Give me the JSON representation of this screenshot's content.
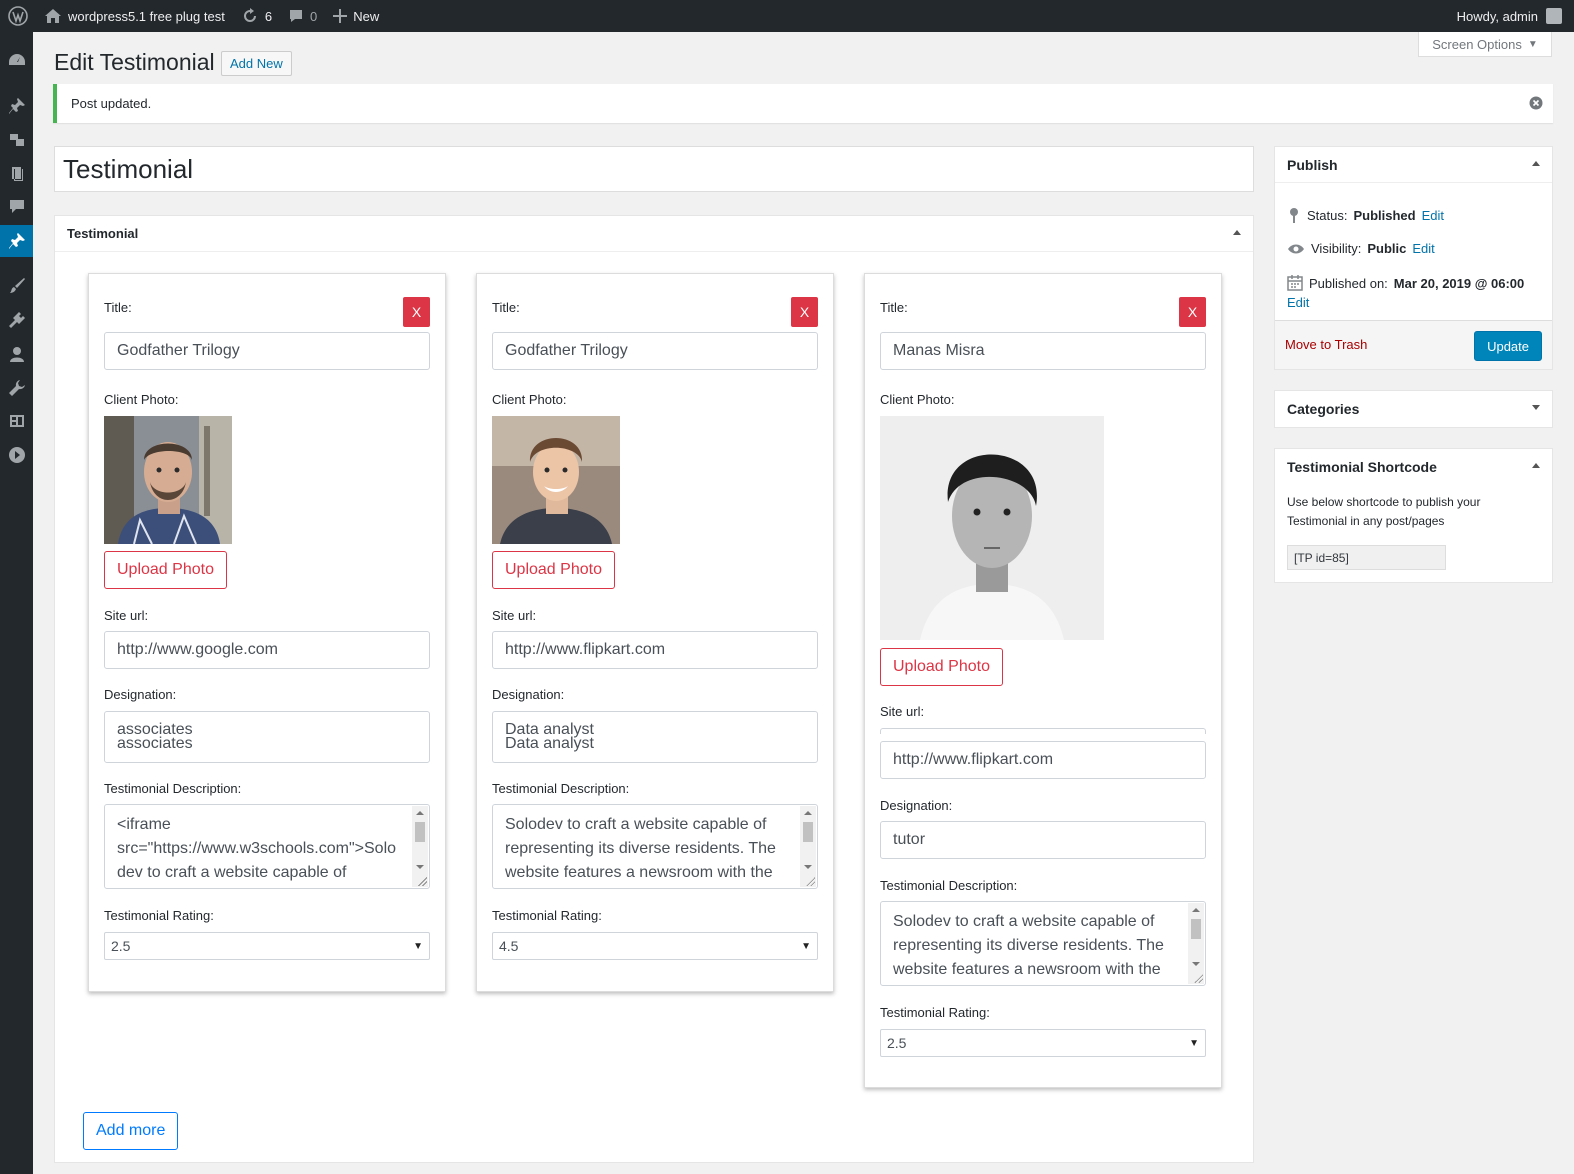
{
  "adminbar": {
    "site_name": "wordpress5.1 free plug test",
    "updates_count": "6",
    "comments_count": "0",
    "new_label": "New",
    "greeting": "Howdy, admin"
  },
  "screen_options": "Screen Options",
  "page_title": "Edit Testimonial",
  "add_new_label": "Add New",
  "notice": "Post updated.",
  "post_title": "Testimonial",
  "metabox": {
    "title": "Testimonial",
    "labels": {
      "title": "Title:",
      "client_photo": "Client Photo:",
      "site_url": "Site url:",
      "designation": "Designation:",
      "description": "Testimonial Description:",
      "rating": "Testimonial Rating:"
    },
    "remove_label": "X",
    "upload_label": "Upload Photo",
    "add_more_label": "Add more",
    "cards": [
      {
        "title": "Godfather Trilogy",
        "site_url": "http://www.google.com",
        "designation_1": "associates",
        "designation_2": "associates",
        "description_lines": [
          "<iframe",
          "src=\"https://www.w3schools.com\">Solo",
          "dev to craft a website capable of"
        ],
        "rating": "2.5"
      },
      {
        "title": "Godfather Trilogy",
        "site_url": "http://www.flipkart.com",
        "designation_1": "Data analyst",
        "designation_2": "Data analyst",
        "description_lines": [
          "Solodev to craft a website capable of",
          "representing its diverse residents. The",
          "website features a newsroom with the"
        ],
        "rating": "4.5"
      },
      {
        "title": "Manas Misra",
        "site_url": "http://www.flipkart.com",
        "designation": "tutor",
        "description_lines": [
          "Solodev to craft a website capable of",
          "representing its diverse residents. The",
          "website features a newsroom with the"
        ],
        "rating": "2.5"
      }
    ]
  },
  "publish": {
    "title": "Publish",
    "status_label": "Status:",
    "status_value": "Published",
    "visibility_label": "Visibility:",
    "visibility_value": "Public",
    "published_label": "Published on:",
    "published_value": "Mar 20, 2019 @ 06:00",
    "edit_label": "Edit",
    "trash_label": "Move to Trash",
    "update_label": "Update"
  },
  "categories_title": "Categories",
  "shortcode": {
    "title": "Testimonial Shortcode",
    "text": "Use below shortcode to publish your Testimonial in any post/pages",
    "value": "[TP id=85]"
  },
  "colors": {
    "adminbar": "#23282d",
    "accent": "#0073aa",
    "danger": "#dc3545",
    "primary_outline": "#007bff",
    "notice_success": "#46b450"
  }
}
